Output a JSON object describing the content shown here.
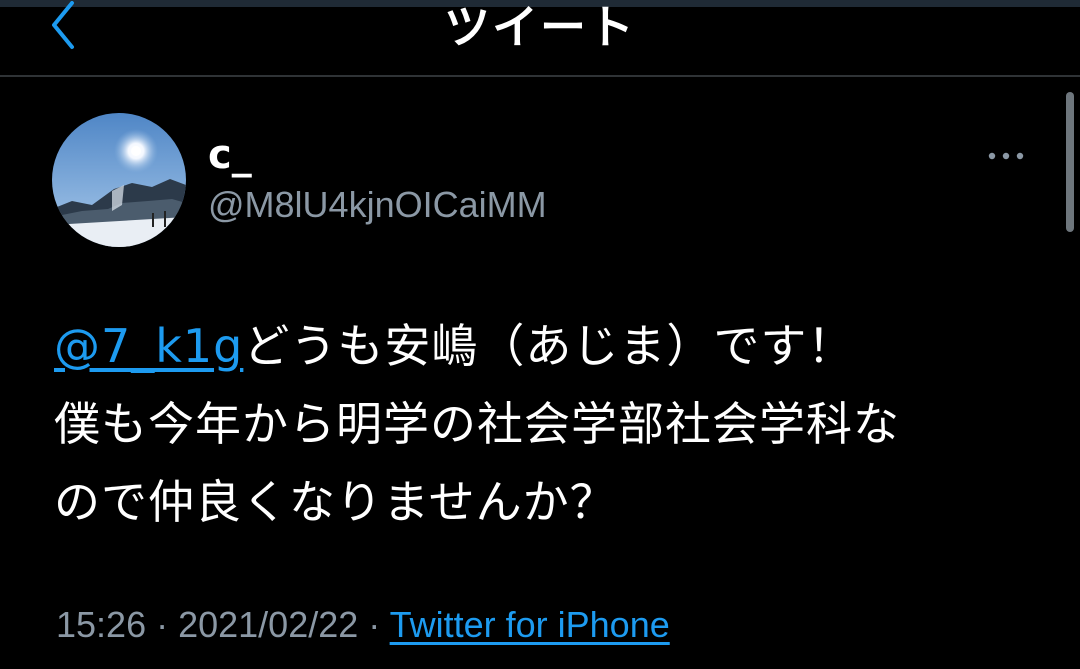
{
  "header": {
    "title": "ツイート",
    "back_icon": "chevron-left-icon"
  },
  "tweet": {
    "display_name": "c_",
    "username": "@M8lU4kjnOICaiMM",
    "avatar_icon": "snowy-mountain-avatar",
    "more_icon": "more-horizontal-icon",
    "mention": "@7_k1g",
    "text_line1": "どうも安嶋（あじま）です！",
    "text_line2": "僕も今年から明学の社会学部社会学科な",
    "text_line3": "ので仲良くなりませんか？",
    "time": "15:26",
    "date": "2021/02/22",
    "separator": " · ",
    "source": "Twitter for iPhone"
  },
  "colors": {
    "background": "#000000",
    "text": "#ffffff",
    "secondary": "#8b98a5",
    "link": "#1d9bf0",
    "divider": "#2f3336"
  }
}
